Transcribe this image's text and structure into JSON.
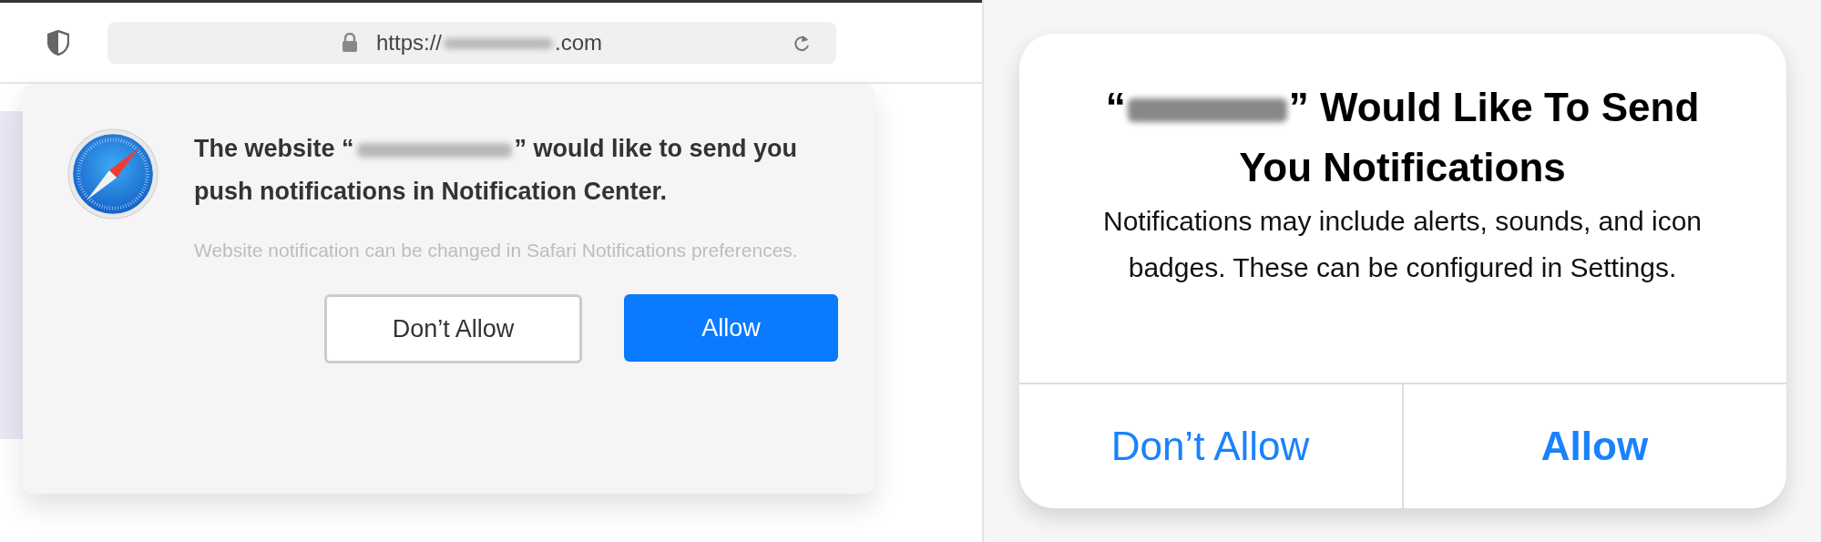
{
  "browser": {
    "url_before": "https://",
    "url_after": ".com"
  },
  "safari_prompt": {
    "title_before": "The website “",
    "title_after": "” would like to send you push notifications in Notification Center.",
    "note": "Website notification can be changed in Safari Notifications preferences.",
    "buttons": [
      {
        "label": "Don’t Allow",
        "kind": "secondary"
      },
      {
        "label": "Allow",
        "kind": "primary"
      }
    ]
  },
  "ios_alert": {
    "title_before": "“",
    "title_after": "” Would Like To Send You Notifications",
    "message": "Notifications may include alerts, sounds, and icon badges. These can be configured in Settings.",
    "buttons": [
      {
        "label": "Don’t Allow",
        "kind": "normal"
      },
      {
        "label": "Allow",
        "kind": "bold"
      }
    ]
  }
}
